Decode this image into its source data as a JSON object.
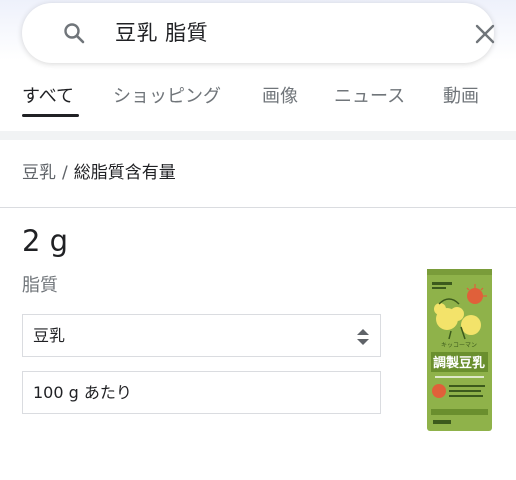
{
  "search": {
    "query": "豆乳 脂質"
  },
  "tabs": [
    {
      "label": "すべて",
      "active": true
    },
    {
      "label": "ショッピング",
      "active": false
    },
    {
      "label": "画像",
      "active": false
    },
    {
      "label": "ニュース",
      "active": false
    },
    {
      "label": "動画",
      "active": false
    }
  ],
  "breadcrumb": {
    "item": "豆乳",
    "separator": "/",
    "attribute": "総脂質含有量"
  },
  "result": {
    "value": "2 g",
    "nutrient": "脂質"
  },
  "food_select": {
    "selected": "豆乳"
  },
  "serving": {
    "value": "100 g あたり"
  },
  "product_image": {
    "brand_text": "キッコーマン",
    "product_text": "調製豆乳",
    "colors": {
      "package": "#8fb24a",
      "flower": "#f3e36a",
      "dark": "#3c5a1c"
    }
  },
  "colors": {
    "text": "#202124",
    "muted": "#70757a",
    "border": "#dadce0",
    "band": "#f1f3f4"
  }
}
